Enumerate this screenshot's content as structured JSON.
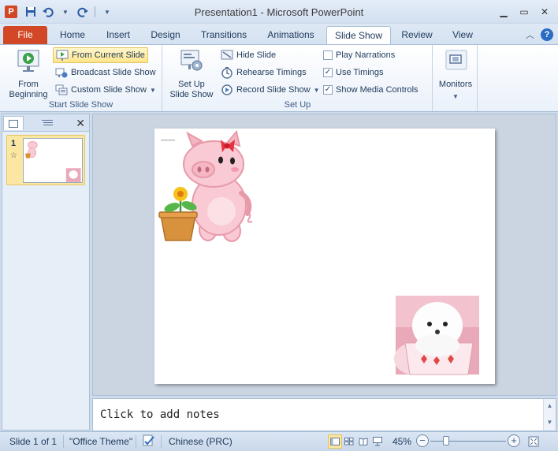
{
  "window": {
    "title": "Presentation1 - Microsoft PowerPoint",
    "app_icon_letter": "P"
  },
  "quick_access": [
    "save-icon",
    "undo-icon",
    "redo-icon",
    "customize-icon"
  ],
  "tabs": [
    {
      "label": "File"
    },
    {
      "label": "Home"
    },
    {
      "label": "Insert"
    },
    {
      "label": "Design"
    },
    {
      "label": "Transitions"
    },
    {
      "label": "Animations"
    },
    {
      "label": "Slide Show"
    },
    {
      "label": "Review"
    },
    {
      "label": "View"
    }
  ],
  "active_tab": "Slide Show",
  "ribbon": {
    "start_group": {
      "label": "Start Slide Show",
      "from_beginning": "From Beginning",
      "from_current": "From Current Slide",
      "broadcast": "Broadcast Slide Show",
      "custom": "Custom Slide Show"
    },
    "setup_group": {
      "label": "Set Up",
      "setup_show": "Set Up Slide Show",
      "hide_slide": "Hide Slide",
      "rehearse": "Rehearse Timings",
      "record": "Record Slide Show",
      "play_narrations": {
        "label": "Play Narrations",
        "checked": false
      },
      "use_timings": {
        "label": "Use Timings",
        "checked": true
      },
      "show_media": {
        "label": "Show Media Controls",
        "checked": true
      }
    },
    "monitors_group": {
      "label": "Monitors"
    }
  },
  "slides_panel": {
    "slides": [
      {
        "number": "1",
        "has_transition": true
      }
    ]
  },
  "notes": {
    "placeholder": "Click to add notes"
  },
  "status_bar": {
    "slide_info": "Slide 1 of 1",
    "theme": "\"Office Theme\"",
    "language": "Chinese (PRC)",
    "zoom": "45%"
  },
  "colors": {
    "file_tab": "#d24726",
    "ribbon_highlight": "#ffe58a",
    "window_bg": "#cfdcec"
  }
}
